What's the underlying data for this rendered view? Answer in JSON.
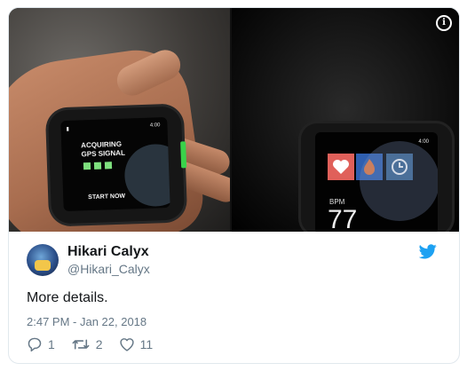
{
  "media": {
    "left_watch": {
      "status_right": "4:00",
      "headline_line1": "ACQUIRING",
      "headline_line2": "GPS SIGNAL",
      "cta": "START NOW"
    },
    "right_watch": {
      "status_right": "4:00",
      "label": "BPM",
      "value": "77"
    },
    "info_icon": "info-icon"
  },
  "tweet": {
    "author_name": "Hikari Calyx",
    "author_handle": "@Hikari_Calyx",
    "text": "More details.",
    "timestamp": "2:47 PM - Jan 22, 2018",
    "actions": {
      "replies": "1",
      "retweets": "2",
      "likes": "11"
    }
  },
  "colors": {
    "twitter_blue": "#1da1f2",
    "meta_gray": "#657786",
    "text_dark": "#14171a"
  }
}
